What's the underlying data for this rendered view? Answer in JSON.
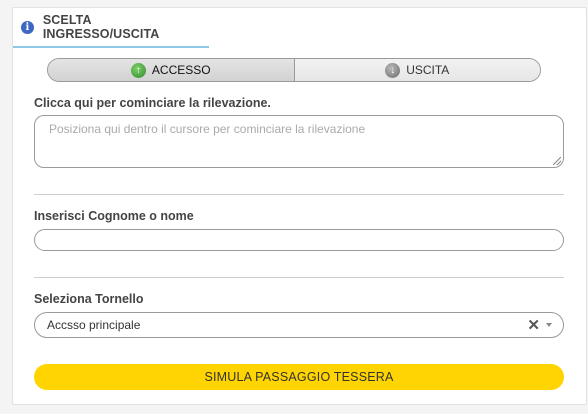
{
  "panel": {
    "title": "SCELTA INGRESSO/USCITA",
    "info_icon_glyph": "i"
  },
  "toggle": {
    "entry_label": "ACCESSO",
    "exit_label": "USCITA",
    "selected": "ACCESSO"
  },
  "rilevazione": {
    "label": "Clicca qui per cominciare la rilevazione.",
    "placeholder": "Posiziona qui dentro il cursore per cominciare la rilevazione"
  },
  "search": {
    "label": "Inserisci Cognome o nome",
    "value": ""
  },
  "tornello": {
    "label": "Seleziona Tornello",
    "selected": "Accsso principale"
  },
  "simulate_button": {
    "label": "SIMULA PASSAGGIO TESSERA"
  },
  "colors": {
    "accent_yellow": "#ffd400",
    "info_blue": "#3d67c4",
    "tab_underline": "#8fc7e6"
  }
}
